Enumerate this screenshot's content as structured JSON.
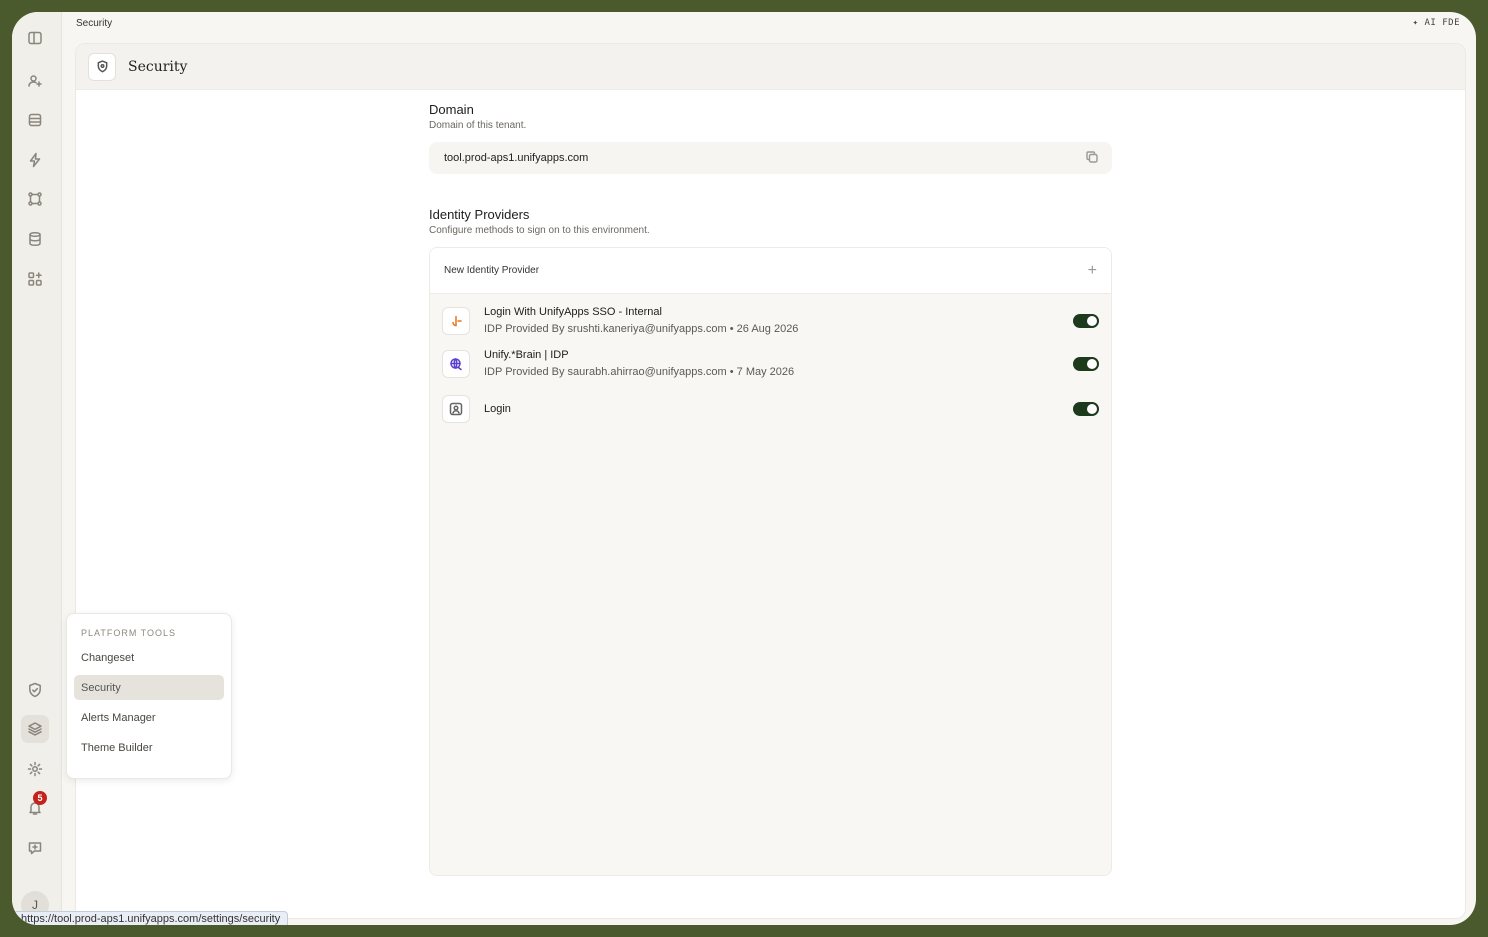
{
  "topbar": {
    "breadcrumb": "Security",
    "ai_label": "✦ AI FDE"
  },
  "page": {
    "title": "Security"
  },
  "domain": {
    "title": "Domain",
    "description": "Domain of this tenant.",
    "value": "tool.prod-aps1.unifyapps.com"
  },
  "identity": {
    "title": "Identity Providers",
    "description": "Configure methods to sign on to this environment.",
    "new_label": "New Identity Provider",
    "providers": [
      {
        "name": "Login With UnifyApps SSO - Internal",
        "meta": "IDP Provided By srushti.kaneriya@unifyapps.com • 26 Aug 2026",
        "enabled": true
      },
      {
        "name": "Unify.*Brain | IDP",
        "meta": "IDP Provided By saurabh.ahirrao@unifyapps.com • 7 May 2026",
        "enabled": true
      },
      {
        "name": "Login",
        "meta": "",
        "enabled": true
      }
    ]
  },
  "platform_tools": {
    "title": "PLATFORM TOOLS",
    "items": [
      "Changeset",
      "Security",
      "Alerts Manager",
      "Theme Builder"
    ],
    "active": "Security"
  },
  "rail": {
    "notification_count": "5",
    "avatar_initial": "J"
  },
  "status_url": "https://tool.prod-aps1.unifyapps.com/settings/security",
  "colors": {
    "toggle_on": "#1d3a1d",
    "badge": "#c4221c",
    "frame": "#4a5a2c"
  }
}
